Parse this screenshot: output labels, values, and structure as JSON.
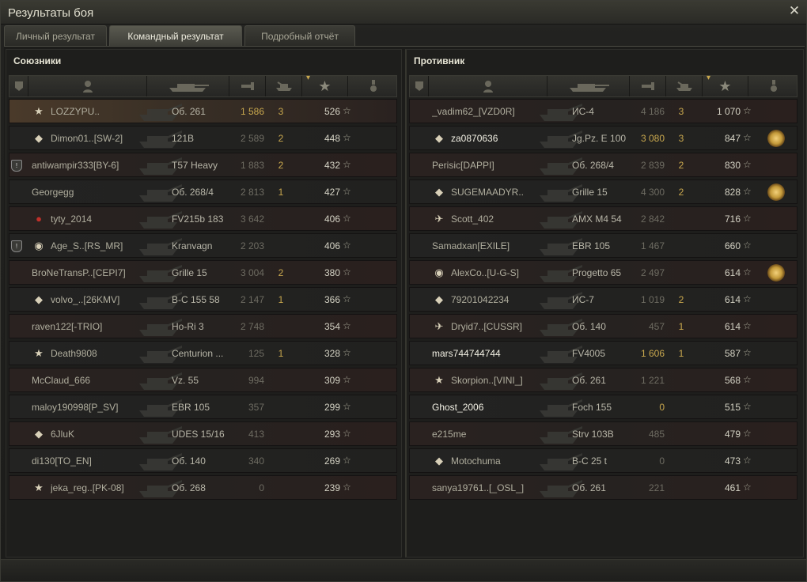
{
  "window": {
    "title": "Результаты боя",
    "close_label": "✕"
  },
  "tabs": [
    {
      "label": "Личный результат",
      "active": false
    },
    {
      "label": "Командный результат",
      "active": true
    },
    {
      "label": "Подробный отчёт",
      "active": false
    }
  ],
  "columns": [
    "clan",
    "player",
    "vehicle",
    "damage",
    "kills",
    "xp",
    "medal"
  ],
  "allies": {
    "title": "Союзники",
    "rows": [
      {
        "clan": false,
        "badge": "★",
        "name": "LOZZYPU..",
        "vehicle": "Об. 261",
        "damage": "1 586",
        "kills": "3",
        "xp": "526",
        "me": true,
        "hi": true
      },
      {
        "clan": false,
        "badge": "◆",
        "name": "Dimon01..[SW-2]",
        "vehicle": "121B",
        "damage": "2 589",
        "kills": "2",
        "xp": "448"
      },
      {
        "clan": true,
        "badge": "",
        "name": "antiwampir333[BY-6]",
        "vehicle": "T57 Heavy",
        "damage": "1 883",
        "kills": "2",
        "xp": "432"
      },
      {
        "clan": false,
        "badge": "",
        "name": "Georgegg",
        "vehicle": "Об. 268/4",
        "damage": "2 813",
        "kills": "1",
        "xp": "427"
      },
      {
        "clan": false,
        "badge": "●",
        "name": "tyty_2014",
        "vehicle": "FV215b 183",
        "damage": "3 642",
        "kills": "",
        "xp": "406"
      },
      {
        "clan": true,
        "badge": "◉",
        "name": "Age_S..[RS_MR]",
        "vehicle": "Kranvagn",
        "damage": "2 203",
        "kills": "",
        "xp": "406"
      },
      {
        "clan": false,
        "badge": "",
        "name": "BroNeTransP..[CEPI7]",
        "vehicle": "Grille 15",
        "damage": "3 004",
        "kills": "2",
        "xp": "380"
      },
      {
        "clan": false,
        "badge": "◆",
        "name": "volvo_..[26KMV]",
        "vehicle": "B-C 155 58",
        "damage": "2 147",
        "kills": "1",
        "xp": "366"
      },
      {
        "clan": false,
        "badge": "",
        "name": "raven122[-TRIO]",
        "vehicle": "Ho-Ri 3",
        "damage": "2 748",
        "kills": "",
        "xp": "354"
      },
      {
        "clan": false,
        "badge": "★",
        "name": "Death9808",
        "vehicle": "Centurion ...",
        "damage": "125",
        "kills": "1",
        "xp": "328"
      },
      {
        "clan": false,
        "badge": "",
        "name": "McClaud_666",
        "vehicle": "Vz. 55",
        "damage": "994",
        "kills": "",
        "xp": "309"
      },
      {
        "clan": false,
        "badge": "",
        "name": "maloy190998[P_SV]",
        "vehicle": "EBR 105",
        "damage": "357",
        "kills": "",
        "xp": "299"
      },
      {
        "clan": false,
        "badge": "◆",
        "name": "6JluK",
        "vehicle": "UDES 15/16",
        "damage": "413",
        "kills": "",
        "xp": "293"
      },
      {
        "clan": false,
        "badge": "",
        "name": "di130[TO_EN]",
        "vehicle": "Об. 140",
        "damage": "340",
        "kills": "",
        "xp": "269"
      },
      {
        "clan": false,
        "badge": "★",
        "name": "jeka_reg..[PK-08]",
        "vehicle": "Об. 268",
        "damage": "0",
        "kills": "",
        "xp": "239"
      }
    ]
  },
  "enemies": {
    "title": "Противник",
    "rows": [
      {
        "badge": "",
        "name": "_vadim62_[VZD0R]",
        "vehicle": "ИС-4",
        "damage": "4 186",
        "kills": "3",
        "xp": "1 070",
        "medal": false
      },
      {
        "badge": "◆",
        "name": "za0870636",
        "vehicle": "Jg.Pz. E 100",
        "damage": "3 080",
        "kills": "3",
        "xp": "847",
        "medal": true,
        "white": true,
        "hi": true
      },
      {
        "badge": "",
        "name": "Perisic[DAPPI]",
        "vehicle": "Об. 268/4",
        "damage": "2 839",
        "kills": "2",
        "xp": "830",
        "medal": false
      },
      {
        "badge": "◆",
        "name": "SUGEMAADYR..",
        "vehicle": "Grille 15",
        "damage": "4 300",
        "kills": "2",
        "xp": "828",
        "medal": true
      },
      {
        "badge": "✈",
        "name": "Scott_402",
        "vehicle": "AMX M4 54",
        "damage": "2 842",
        "kills": "",
        "xp": "716",
        "medal": false
      },
      {
        "badge": "",
        "name": "Samadxan[EXILE]",
        "vehicle": "EBR 105",
        "damage": "1 467",
        "kills": "",
        "xp": "660",
        "medal": false
      },
      {
        "badge": "◉",
        "name": "AlexCo..[U-G-S]",
        "vehicle": "Progetto 65",
        "damage": "2 497",
        "kills": "",
        "xp": "614",
        "medal": true
      },
      {
        "badge": "◆",
        "name": "79201042234",
        "vehicle": "ИС-7",
        "damage": "1 019",
        "kills": "2",
        "xp": "614",
        "medal": false
      },
      {
        "badge": "✈",
        "name": "Dryid7..[CUSSR]",
        "vehicle": "Об. 140",
        "damage": "457",
        "kills": "1",
        "xp": "614",
        "medal": false
      },
      {
        "badge": "",
        "name": "mars744744744",
        "vehicle": "FV4005",
        "damage": "1 606",
        "kills": "1",
        "xp": "587",
        "medal": false,
        "white": true,
        "hi": true
      },
      {
        "badge": "★",
        "name": "Skorpion..[VINI_]",
        "vehicle": "Об. 261",
        "damage": "1 221",
        "kills": "",
        "xp": "568",
        "medal": false
      },
      {
        "badge": "",
        "name": "Ghost_2006",
        "vehicle": "Foch 155",
        "damage": "0",
        "kills": "",
        "xp": "515",
        "medal": false,
        "white": true,
        "hi": true
      },
      {
        "badge": "",
        "name": "e215me",
        "vehicle": "Strv 103B",
        "damage": "485",
        "kills": "",
        "xp": "479",
        "medal": false
      },
      {
        "badge": "◆",
        "name": "Motochuma",
        "vehicle": "B-C 25 t",
        "damage": "0",
        "kills": "",
        "xp": "473",
        "medal": false
      },
      {
        "badge": "",
        "name": "sanya19761..[_OSL_]",
        "vehicle": "Об. 261",
        "damage": "221",
        "kills": "",
        "xp": "461",
        "medal": false
      }
    ]
  },
  "icons": {
    "sort": "▾",
    "star": "☆"
  },
  "colors": {
    "accent_gold": "#c9a84e",
    "text": "#b8b6a8",
    "row_red": "#2a2220"
  }
}
